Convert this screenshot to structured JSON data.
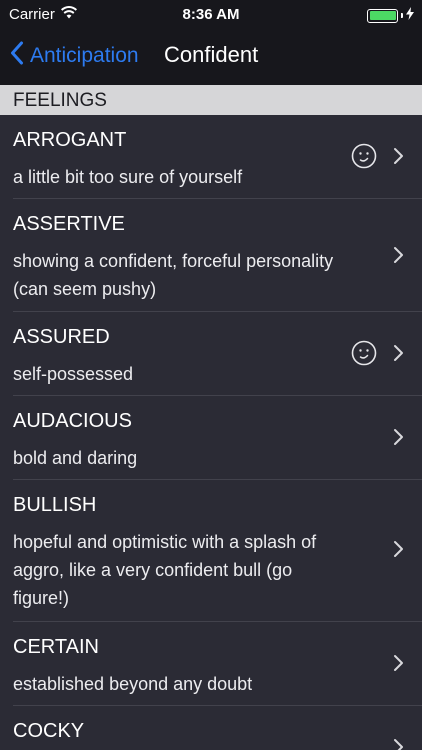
{
  "status_bar": {
    "carrier": "Carrier",
    "time": "8:36 AM",
    "battery_level": 1.0,
    "battery_color": "#4cd964"
  },
  "nav": {
    "back_label": "Anticipation",
    "title": "Confident",
    "accent_color": "#2d7bf0"
  },
  "section": {
    "header": "FEELINGS"
  },
  "rows": [
    {
      "title": "ARROGANT",
      "desc": "a little bit too sure of yourself",
      "has_smiley": true
    },
    {
      "title": "ASSERTIVE",
      "desc": "showing a confident, forceful personality (can seem pushy)",
      "has_smiley": false
    },
    {
      "title": "ASSURED",
      "desc": "self-possessed",
      "has_smiley": true
    },
    {
      "title": "AUDACIOUS",
      "desc": "bold and daring",
      "has_smiley": false
    },
    {
      "title": "BULLISH",
      "desc": "hopeful and optimistic with a splash of aggro, like a very confident bull (go figure!)",
      "has_smiley": false
    },
    {
      "title": "CERTAIN",
      "desc": "established beyond any doubt",
      "has_smiley": false
    },
    {
      "title": "COCKY",
      "desc": "",
      "has_smiley": false
    }
  ]
}
